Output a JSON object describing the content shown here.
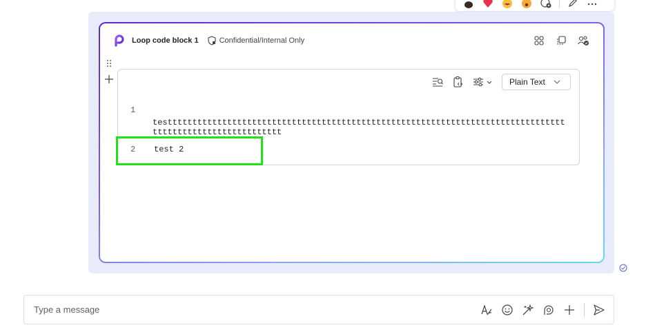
{
  "loop": {
    "title": "Loop code block 1",
    "sensitivity_label": "Confidential/Internal Only"
  },
  "code_block": {
    "language": "Plain Text",
    "lines": [
      {
        "number": "1",
        "text": "testttttttttttttttttttttttttttttttttttttttttttttttttttttttttttttttttttttttttttttttttttttttttttttttttttttttttt"
      },
      {
        "number": "2",
        "text": "test 2"
      }
    ]
  },
  "compose": {
    "placeholder": "Type a message"
  },
  "colors": {
    "bubble_bg": "#e8ebfa",
    "loop_gradient_start": "#5b2ac8",
    "loop_gradient_end": "#6ad6f5",
    "highlight_border": "#22e01a",
    "icon_gray": "#616161"
  },
  "icons": {
    "reactions": [
      "like-icon",
      "heart-icon",
      "laugh-icon",
      "surprised-icon",
      "add-reaction-icon",
      "edit-icon",
      "more-icon"
    ],
    "header": [
      "loop-logo-icon",
      "sensitivity-shield-icon",
      "workspace-icon",
      "copy-component-icon",
      "share-people-icon"
    ],
    "code_toolbar": [
      "wrap-text-icon",
      "copy-code-icon",
      "settings-sliders-icon",
      "chevron-down-icon"
    ],
    "compose": [
      "format-icon",
      "emoji-icon",
      "copilot-icon",
      "loop-icon",
      "add-icon",
      "send-icon"
    ]
  }
}
